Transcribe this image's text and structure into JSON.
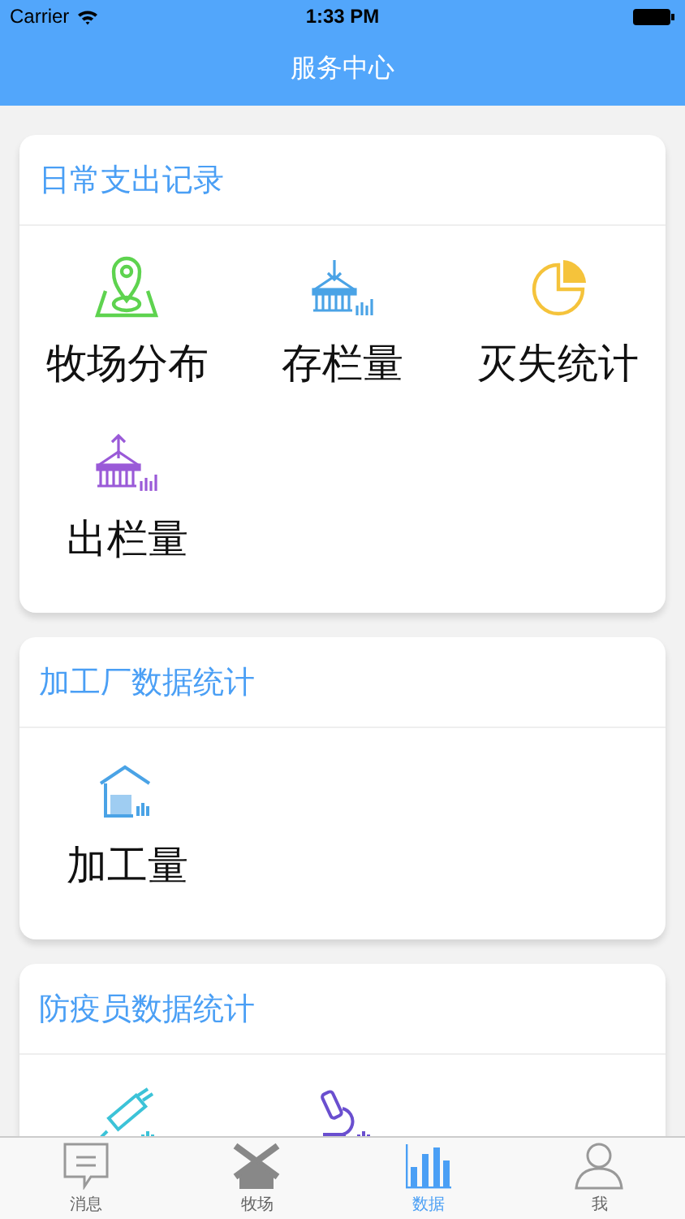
{
  "status_bar": {
    "carrier": "Carrier",
    "time": "1:33 PM"
  },
  "nav": {
    "title": "服务中心"
  },
  "sections": [
    {
      "title": "日常支出记录",
      "items": [
        {
          "kind": "pin",
          "label": "牧场分布"
        },
        {
          "kind": "stock-in",
          "label": "存栏量"
        },
        {
          "kind": "pie",
          "label": "灭失统计"
        },
        {
          "kind": "stock-out",
          "label": "出栏量"
        }
      ]
    },
    {
      "title": "加工厂数据统计",
      "items": [
        {
          "kind": "factory",
          "label": "加工量"
        }
      ]
    },
    {
      "title": "防疫员数据统计",
      "items": [
        {
          "kind": "syringe"
        },
        {
          "kind": "microscope"
        }
      ]
    }
  ],
  "tabs": [
    {
      "kind": "message",
      "label": "消息",
      "selected": false
    },
    {
      "kind": "ranch",
      "label": "牧场",
      "selected": false
    },
    {
      "kind": "data",
      "label": "数据",
      "selected": true
    },
    {
      "kind": "me",
      "label": "我",
      "selected": false
    }
  ]
}
